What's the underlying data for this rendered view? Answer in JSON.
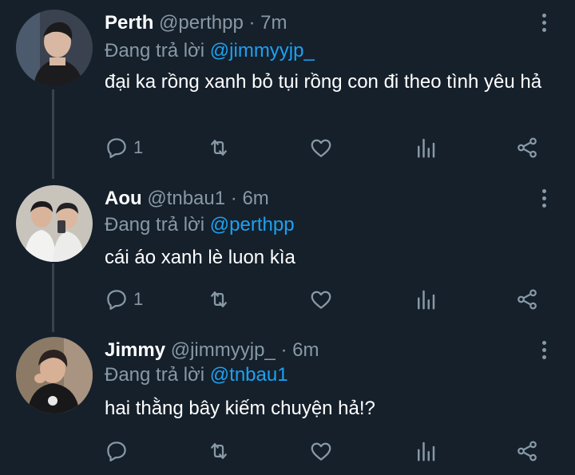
{
  "replying_prefix": "Đang trả lời",
  "colors": {
    "background": "#15202b",
    "muted": "#8899a6",
    "accent": "#1da1f2",
    "thread_line": "#38444d"
  },
  "icons": [
    "more-icon",
    "reply-icon",
    "retweet-icon",
    "like-icon",
    "analytics-icon",
    "share-icon"
  ],
  "tweets": [
    {
      "name": "Perth",
      "handle": "@perthpp",
      "separator": "·",
      "time": "7m",
      "reply_to": "@jimmyyjp_",
      "text": "đại ka rồng xanh bỏ tụi rồng con đi theo tình yêu hả",
      "reply_count": "1"
    },
    {
      "name": "Aou",
      "handle": "@tnbau1",
      "separator": "·",
      "time": "6m",
      "reply_to": "@perthpp",
      "text": "cái áo xanh lè luon kìa",
      "reply_count": "1"
    },
    {
      "name": "Jimmy",
      "handle": "@jimmyyjp_",
      "separator": "·",
      "time": "6m",
      "reply_to": "@tnbau1",
      "text": "hai thằng bây kiếm chuyện hả!?",
      "reply_count": ""
    }
  ]
}
